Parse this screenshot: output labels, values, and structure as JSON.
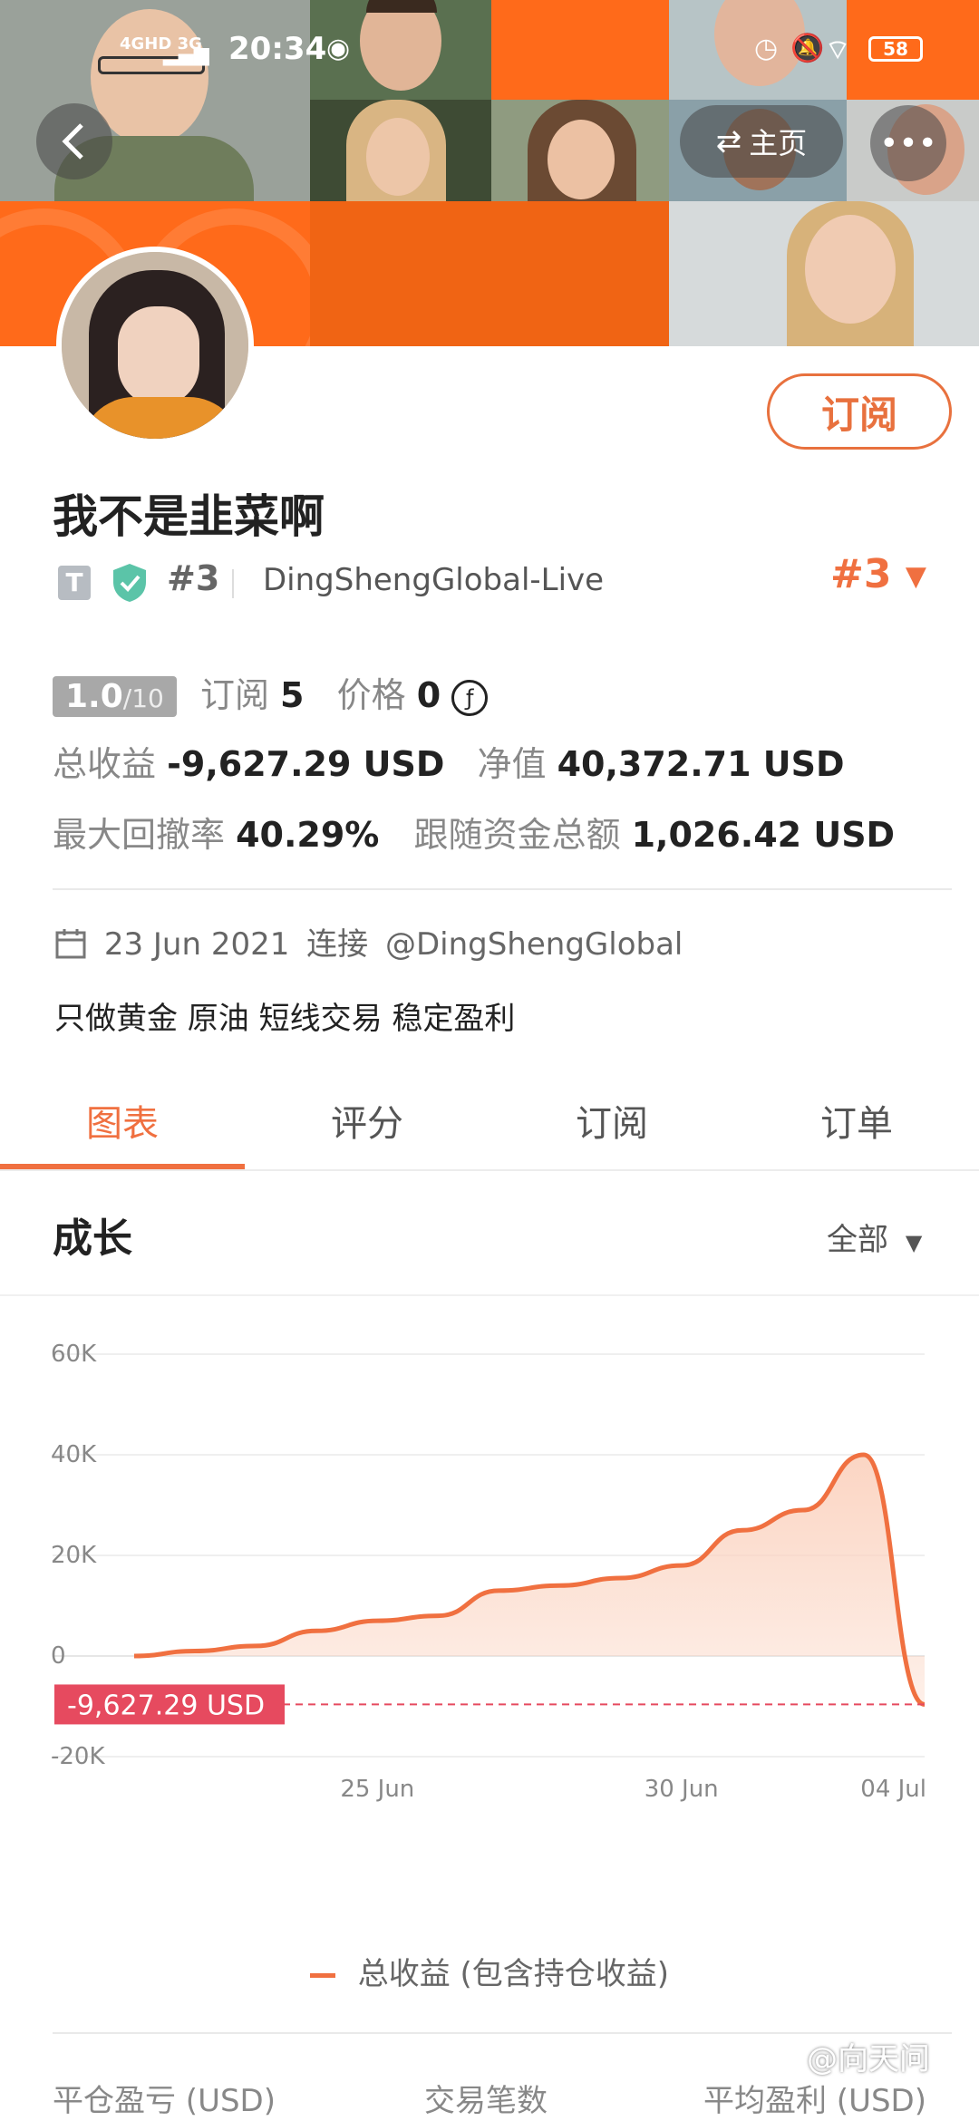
{
  "status_bar": {
    "network": "4GHD 3G",
    "time": "20:34",
    "battery": "58"
  },
  "header": {
    "home_label": "主页"
  },
  "profile": {
    "name": "我不是韭菜啊",
    "badge_t": "T",
    "rank": "#3",
    "broker": "DingShengGlobal-Live",
    "rank_right": "#3",
    "subscribe_label": "订阅"
  },
  "stats": {
    "score": "1.0",
    "score_max": "/10",
    "subs_label": "订阅",
    "subs_value": "5",
    "price_label": "价格",
    "price_value": "0",
    "price_icon": "ƒ",
    "total_profit_label": "总收益",
    "total_profit_value": "-9,627.29 USD",
    "net_label": "净值",
    "net_value": "40,372.71 USD",
    "drawdown_label": "最大回撤率",
    "drawdown_value": "40.29%",
    "follow_label": "跟随资金总额",
    "follow_value": "1,026.42 USD"
  },
  "info": {
    "date": "23 Jun 2021",
    "connect_label": "连接",
    "account": "@DingShengGlobal",
    "description": "只做黄金 原油 短线交易 稳定盈利"
  },
  "tabs": [
    "图表",
    "评分",
    "订阅",
    "订单"
  ],
  "growth": {
    "title": "成长",
    "filter": "全部"
  },
  "chart_data": {
    "type": "area",
    "title": "",
    "xlabel": "",
    "ylabel": "",
    "x_tick_labels": [
      "25 Jun",
      "30 Jun",
      "04 Jul"
    ],
    "y_tick_labels": [
      "60K",
      "40K",
      "20K",
      "0",
      "-20K"
    ],
    "ylim": [
      -20000,
      60000
    ],
    "x": [
      "2021-06-21",
      "2021-06-22",
      "2021-06-23",
      "2021-06-24",
      "2021-06-25",
      "2021-06-26",
      "2021-06-27",
      "2021-06-28",
      "2021-06-29",
      "2021-06-30",
      "2021-07-01",
      "2021-07-02",
      "2021-07-03",
      "2021-07-04"
    ],
    "series": [
      {
        "name": "总收益 (包含持仓收益)",
        "values": [
          0,
          1000,
          2000,
          5000,
          7000,
          8000,
          13000,
          14000,
          15500,
          18000,
          25000,
          29000,
          40000,
          -9627.29
        ]
      }
    ],
    "current_value_label": "-9,627.29 USD",
    "current_value": -9627.29,
    "colors": {
      "line": "#f07040",
      "fill": "#fbd3c0",
      "marker": "#e64a5f"
    }
  },
  "bottom_table": {
    "headers": [
      "平仓盈亏 (USD)",
      "交易笔数",
      "平均盈利 (USD)"
    ]
  },
  "watermark": "@向天问"
}
